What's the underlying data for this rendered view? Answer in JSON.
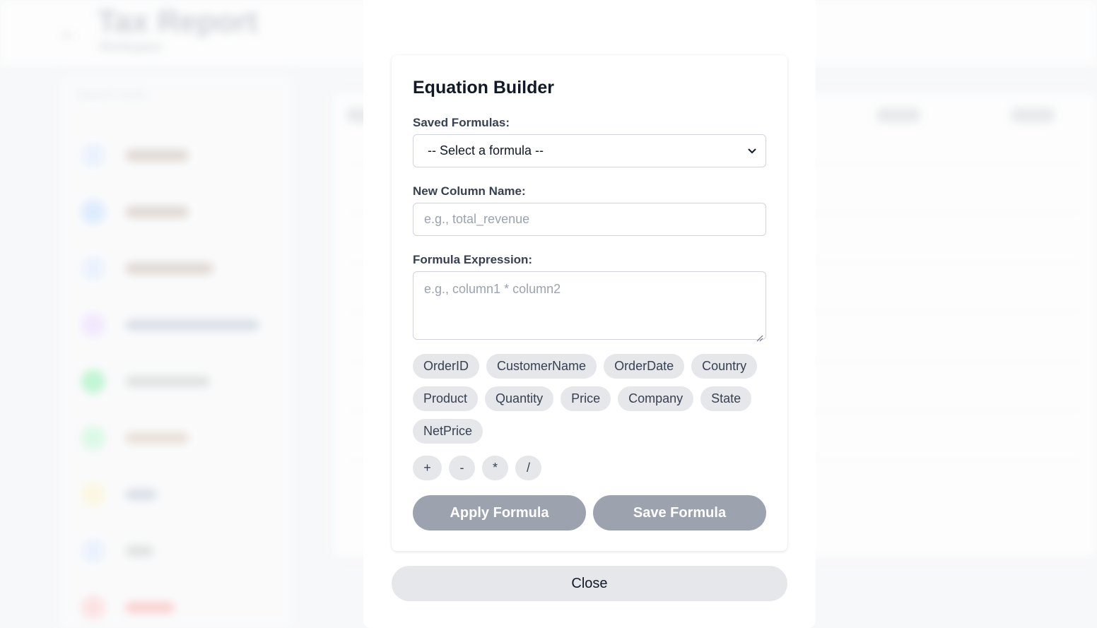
{
  "background": {
    "header_title": "Tax Report",
    "header_subtitle": "Workspace",
    "sidebar_search": "Search tools"
  },
  "modal": {
    "title": "Equation Builder",
    "saved_formulas_label": "Saved Formulas:",
    "saved_formulas_selected": "-- Select a formula --",
    "new_column_label": "New Column Name:",
    "new_column_placeholder": "e.g., total_revenue",
    "formula_label": "Formula Expression:",
    "formula_placeholder": "e.g., column1 * column2",
    "columns": [
      "OrderID",
      "CustomerName",
      "OrderDate",
      "Country",
      "Product",
      "Quantity",
      "Price",
      "Company",
      "State",
      "NetPrice"
    ],
    "operators": [
      "+",
      "-",
      "*",
      "/"
    ],
    "apply_label": "Apply Formula",
    "save_label": "Save Formula",
    "close_label": "Close"
  },
  "colors": {
    "chip_bg": "#e5e7eb",
    "disabled_button": "#9ca3af",
    "close_button": "#e5e7eb"
  },
  "icons": {
    "select_chevron": "chevron-down-icon",
    "resize_grip": "resize-grip-icon",
    "back": "arrow-left-icon"
  }
}
